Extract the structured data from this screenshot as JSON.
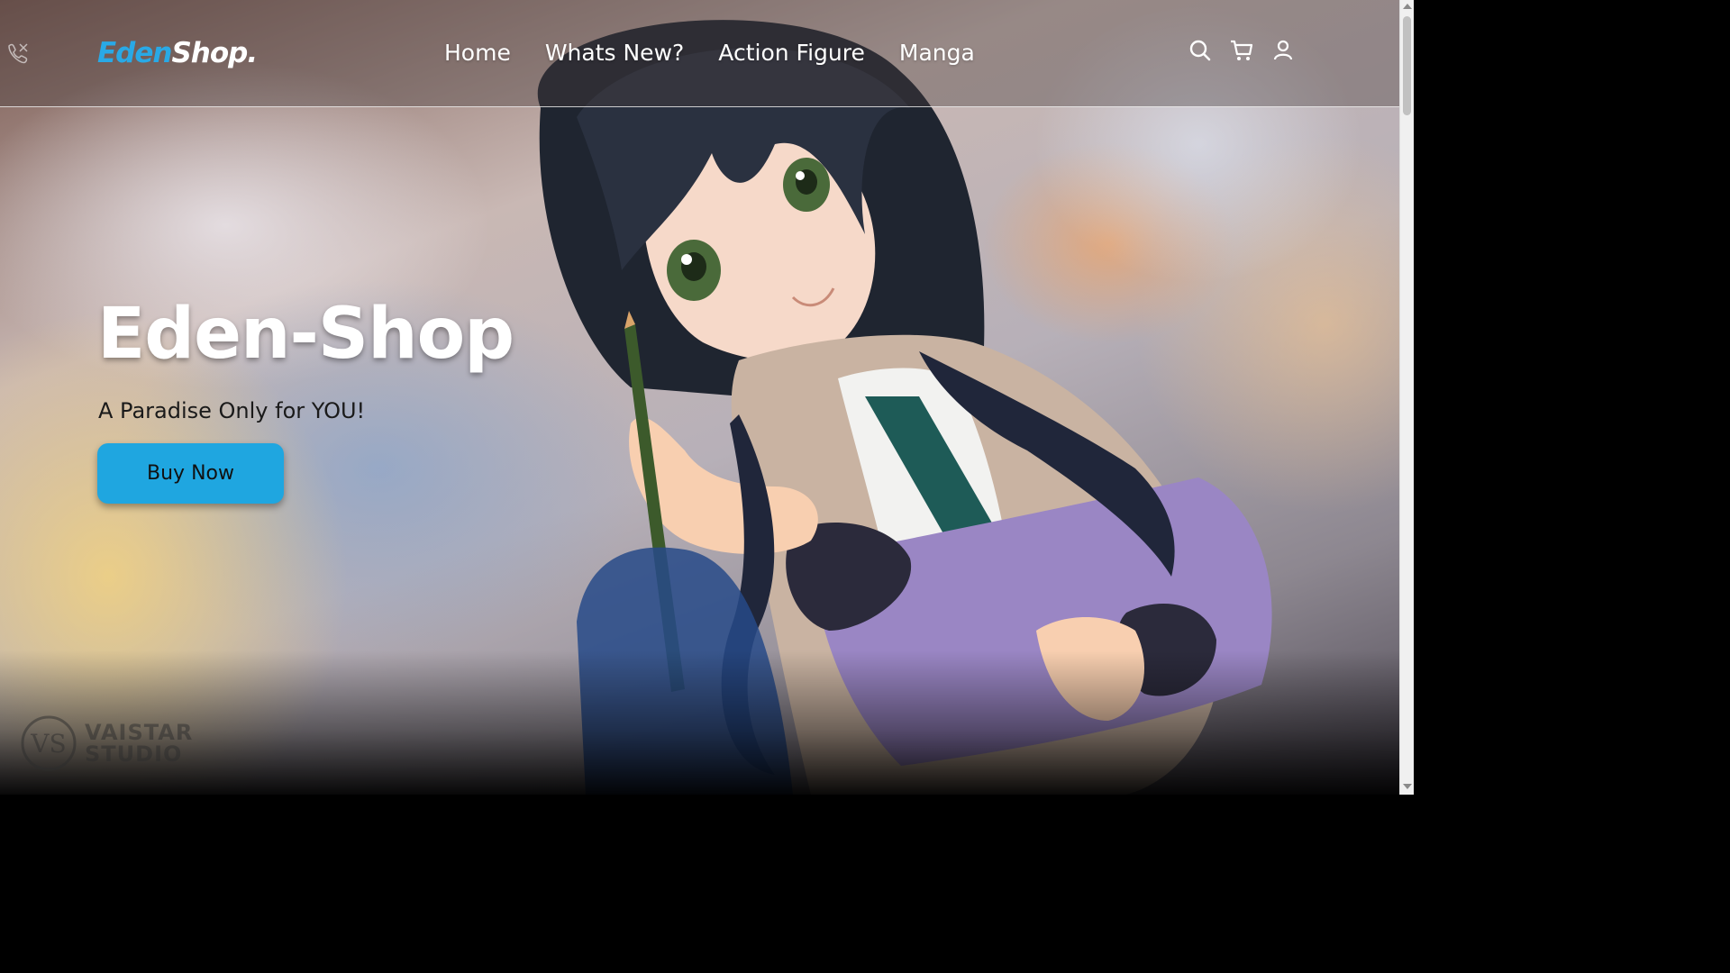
{
  "brand": {
    "logo_part1": "Eden",
    "logo_part2": "Shop.",
    "accent_color": "#29a9e6"
  },
  "nav": {
    "links": [
      {
        "label": "Home"
      },
      {
        "label": "Whats New?"
      },
      {
        "label": "Action Figure"
      },
      {
        "label": "Manga"
      }
    ],
    "icons": [
      "phone-icon",
      "search-icon",
      "cart-icon",
      "user-icon"
    ]
  },
  "hero": {
    "title": "Eden-Shop",
    "subtitle": "A Paradise Only for YOU!",
    "cta_label": "Buy Now",
    "cta_color": "#1fa6e0"
  },
  "watermark": {
    "line1": "VAISTAR",
    "line2": "STUDIO",
    "monogram": "VS"
  }
}
